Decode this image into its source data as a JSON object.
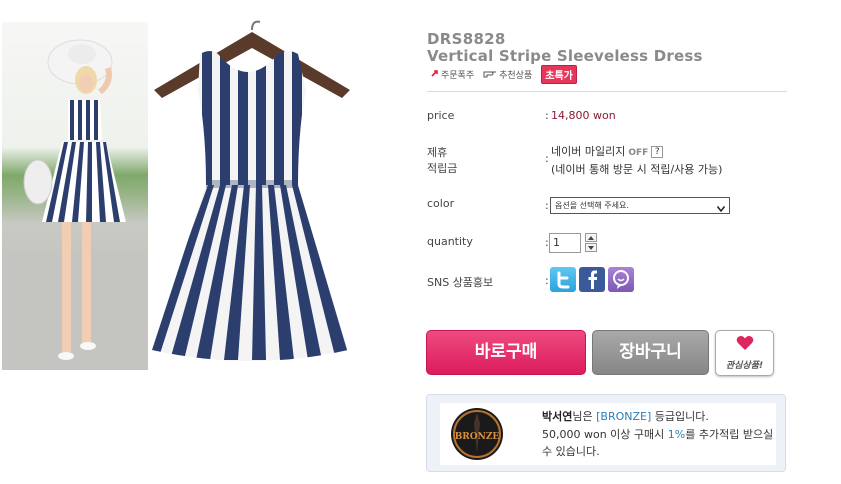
{
  "product": {
    "code": "DRS8828",
    "name": "Vertical Stripe Sleeveless Dress"
  },
  "badges": {
    "order_label": "주문폭주",
    "recommend_label": "추천상품",
    "special_label": "초특가"
  },
  "fields": {
    "price_label": "price",
    "price_value": "14,800 won",
    "reward_label_line1": "제휴",
    "reward_label_line2": "적립금",
    "naver_mileage": "네이버 마일리지",
    "naver_off": "OFF",
    "naver_help": "?",
    "naver_note": "(네이버 통해 방문 시 적립/사용 가능)",
    "color_label": "color",
    "color_select_value": "옵션을 선택해 주세요.",
    "quantity_label": "quantity",
    "quantity_value": "1",
    "sns_label": "SNS 상품홍보",
    "colon": ":"
  },
  "buttons": {
    "buy": "바로구매",
    "cart": "장바구니",
    "wishlist": "관심상품!"
  },
  "membership": {
    "user_name": "박서연",
    "line1_prefix": "님은 ",
    "grade": "[BRONZE]",
    "line1_suffix": " 등급입니다.",
    "line2_prefix": "50,000 won 이상 구매시 ",
    "rate": "1%",
    "line2_suffix": "를 추가적립 받으실 수 있습니다.",
    "badge_text": "BRONZE"
  },
  "colors": {
    "buy_button": "#e0246a",
    "cart_button": "#8f8f8f",
    "price_text": "#8b1a35",
    "grade_text": "#2a7fb8",
    "dress_stripe": "#2c3e6e"
  }
}
